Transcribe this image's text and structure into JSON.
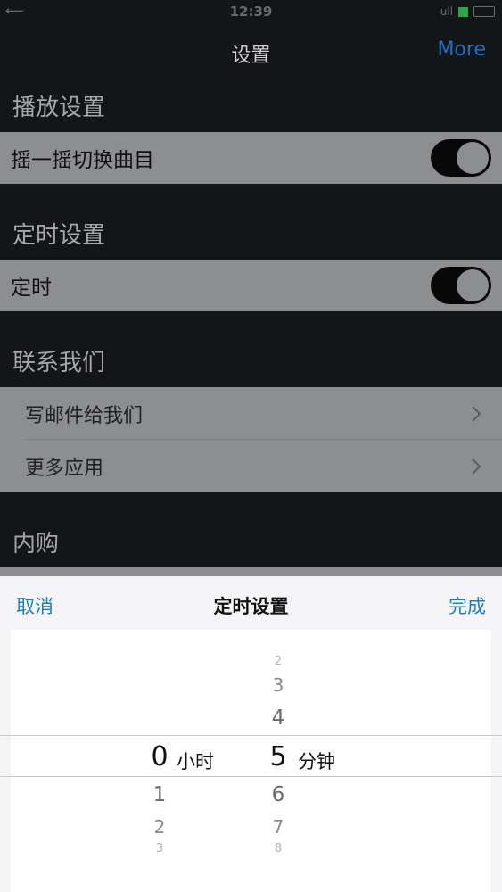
{
  "status_bar": {
    "carrier": "⟵",
    "time": "12:39",
    "signal": "ull"
  },
  "nav": {
    "title": "设置",
    "right_button": "More"
  },
  "sections": {
    "playback": {
      "header": "播放设置",
      "shake_label": "摇一摇切换曲目"
    },
    "timer": {
      "header": "定时设置",
      "timer_label": "定时"
    },
    "contact": {
      "header": "联系我们",
      "email_label": "写邮件给我们",
      "more_apps_label": "更多应用"
    },
    "iap": {
      "header": "内购"
    }
  },
  "sheet": {
    "cancel": "取消",
    "title": "定时设置",
    "done": "完成",
    "hours": {
      "selected": "0",
      "unit": "小时",
      "below": [
        "1",
        "2",
        "3"
      ]
    },
    "minutes": {
      "selected": "5",
      "unit": "分钟",
      "above": [
        "2",
        "3",
        "4"
      ],
      "below": [
        "6",
        "7",
        "8"
      ]
    }
  },
  "colors": {
    "accent": "#1a7cc9",
    "nav_more": "#1a72c2",
    "battery": "#2fa24a"
  }
}
